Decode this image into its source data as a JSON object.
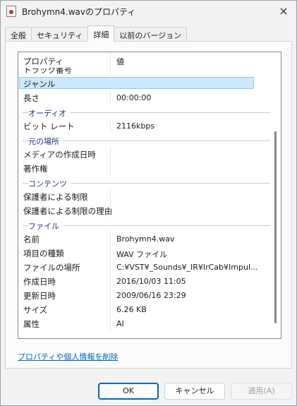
{
  "window": {
    "title": "Brohymn4.wavのプロパティ",
    "close_icon": "×"
  },
  "tabs": [
    {
      "label": "全般"
    },
    {
      "label": "セキュリティ"
    },
    {
      "label": "詳細"
    },
    {
      "label": "以前のバージョン"
    }
  ],
  "active_tab": "詳細",
  "columns": {
    "name": "プロパティ",
    "value": "値"
  },
  "rows": {
    "partial": "トラック番号",
    "genre": {
      "name": "ジャンル",
      "value": ""
    },
    "length": {
      "name": "長さ",
      "value": "00:00:00"
    },
    "group_audio": "オーディオ",
    "bitrate": {
      "name": "ビット レート",
      "value": "2116kbps"
    },
    "group_origin": "元の場所",
    "media_created": {
      "name": "メディアの作成日時",
      "value": ""
    },
    "copyright": {
      "name": "著作権",
      "value": ""
    },
    "group_content": "コンテンツ",
    "parental_rating": {
      "name": "保護者による制限",
      "value": ""
    },
    "parental_reason": {
      "name": "保護者による制限の理由",
      "value": ""
    },
    "group_file": "ファイル",
    "file_name": {
      "name": "名前",
      "value": "Brohymn4.wav"
    },
    "item_type": {
      "name": "項目の種類",
      "value": "WAV ファイル"
    },
    "folder_path": {
      "name": "ファイルの場所",
      "value": "C:¥VST¥_Sounds¥_IR¥IrCab¥Impul..."
    },
    "date_created": {
      "name": "作成日時",
      "value": "2016/10/03 11:05"
    },
    "date_modified": {
      "name": "更新日時",
      "value": "2009/06/16 23:29"
    },
    "size": {
      "name": "サイズ",
      "value": "6.26 KB"
    },
    "attributes": {
      "name": "属性",
      "value": "AI"
    }
  },
  "remove_link": "プロパティや個人情報を削除",
  "buttons": {
    "ok": "OK",
    "cancel": "キャンセル",
    "apply": "適用(A)"
  }
}
